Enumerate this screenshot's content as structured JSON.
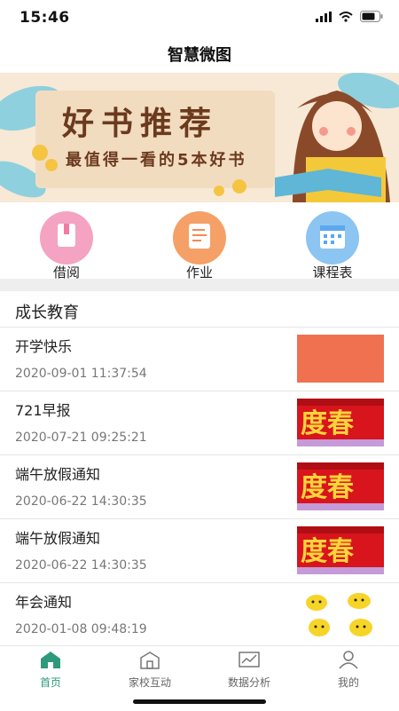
{
  "status": {
    "time": "15:46"
  },
  "header": {
    "title": "智慧微图"
  },
  "banner": {
    "headline": "好书推荐",
    "subline": "最值得一看的5本好书"
  },
  "quick_actions": [
    {
      "label": "借阅",
      "icon": "book-icon",
      "color": "#f27aa3"
    },
    {
      "label": "作业",
      "icon": "homework-icon",
      "color": "#f28b4f"
    },
    {
      "label": "课程表",
      "icon": "calendar-icon",
      "color": "#5aa8ee"
    }
  ],
  "section": {
    "title": "成长教育"
  },
  "articles": [
    {
      "title": "开学快乐",
      "date": "2020-09-01 11:37:54",
      "thumb": "orange-block"
    },
    {
      "title": "721早报",
      "date": "2020-07-21 09:25:21",
      "thumb": "spring-festival-banner"
    },
    {
      "title": "端午放假通知",
      "date": "2020-06-22 14:30:35",
      "thumb": "spring-festival-banner"
    },
    {
      "title": "端午放假通知",
      "date": "2020-06-22 14:30:35",
      "thumb": "spring-festival-banner"
    },
    {
      "title": "年会通知",
      "date": "2020-01-08 09:48:19",
      "thumb": "pikachu-stickers"
    }
  ],
  "tabbar": [
    {
      "label": "首页",
      "icon": "home-icon",
      "active": true
    },
    {
      "label": "家校互动",
      "icon": "school-icon",
      "active": false
    },
    {
      "label": "数据分析",
      "icon": "chart-icon",
      "active": false
    },
    {
      "label": "我的",
      "icon": "user-icon",
      "active": false
    }
  ],
  "colors": {
    "accent": "#2e9a7c",
    "banner_text": "#6b3a1e",
    "orange_thumb": "#ef7150"
  }
}
